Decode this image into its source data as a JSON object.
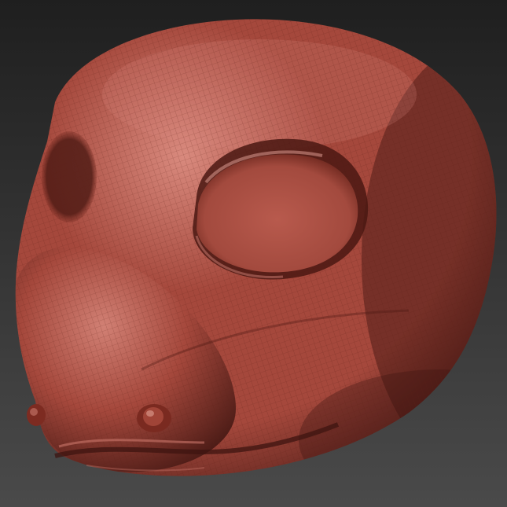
{
  "scene": {
    "subject": "sculpted-creature-head",
    "background_top_color": "#1f1f1f",
    "background_bottom_color": "#4a4a4a",
    "clay_color": "#a5483c",
    "clay_highlight_color": "#d98a7e",
    "clay_shadow_color": "#3d1410",
    "wireframe_color": "#5a1e17"
  }
}
